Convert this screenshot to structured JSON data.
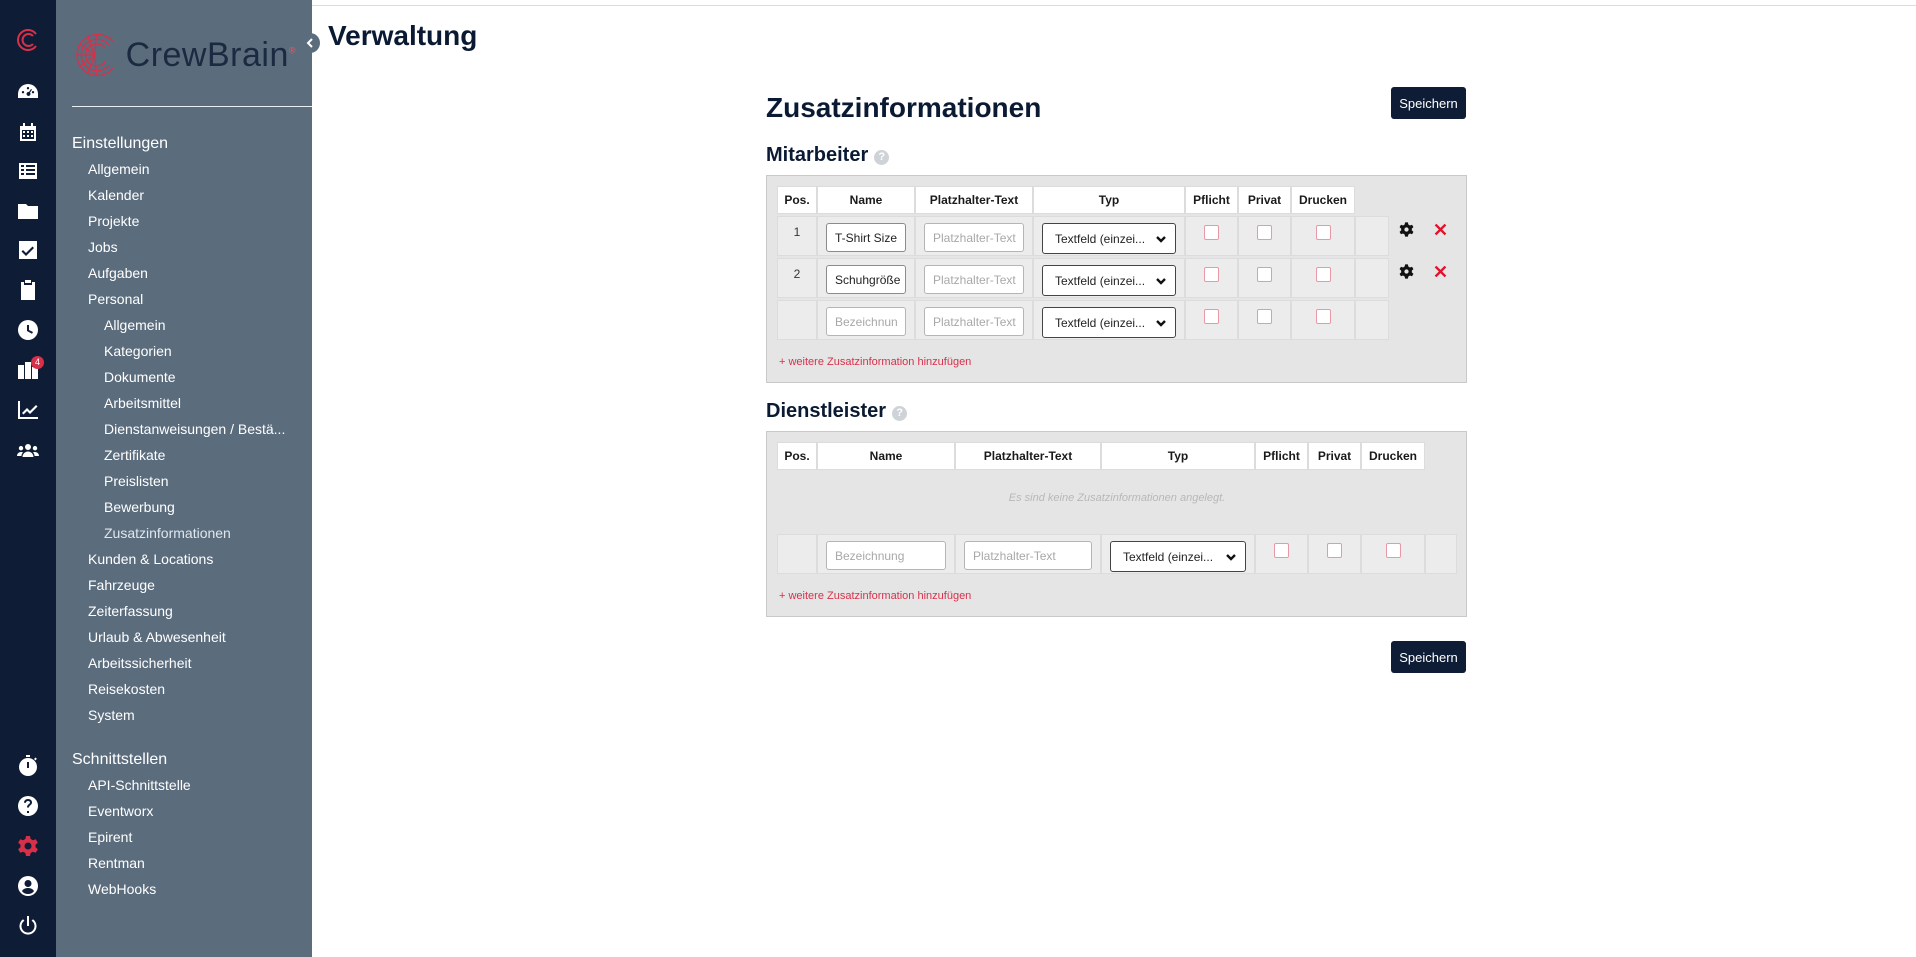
{
  "app": {
    "logo_text": "CrewBrain",
    "logo_mark": "®"
  },
  "page": {
    "title": "Verwaltung",
    "heading": "Zusatzinformationen",
    "save_label": "Speichern"
  },
  "rail": {
    "icons": [
      "logo-icon",
      "dashboard-icon",
      "calendar-icon",
      "list-icon",
      "folder-icon",
      "checkbox-icon",
      "clipboard-icon",
      "clock-icon",
      "tasks-icon",
      "chart-icon",
      "users-icon",
      "stopwatch-icon",
      "help-icon",
      "gear-icon",
      "user-circle-icon",
      "power-icon"
    ],
    "badge": "4",
    "accent": "#d9304a"
  },
  "sidebar": {
    "section1": "Einstellungen",
    "items": [
      "Allgemein",
      "Kalender",
      "Projekte",
      "Jobs",
      "Aufgaben",
      "Personal"
    ],
    "personal_sub": [
      "Allgemein",
      "Kategorien",
      "Dokumente",
      "Arbeitsmittel",
      "Dienstanweisungen / Bestä...",
      "Zertifikate",
      "Preislisten",
      "Bewerbung",
      "Zusatzinformationen"
    ],
    "items2": [
      "Kunden & Locations",
      "Fahrzeuge",
      "Zeiterfassung",
      "Urlaub & Abwesenheit",
      "Arbeitssicherheit",
      "Reisekosten",
      "System"
    ],
    "section2": "Schnittstellen",
    "interfaces": [
      "API-Schnittstelle",
      "Eventworx",
      "Epirent",
      "Rentman",
      "WebHooks"
    ]
  },
  "mitarbeiter": {
    "title": "Mitarbeiter",
    "help": "?",
    "headers": [
      "Pos.",
      "Name",
      "Platzhalter-Text",
      "Typ",
      "Pflicht",
      "Privat",
      "Drucken"
    ],
    "rows": [
      {
        "pos": "1",
        "name": "T-Shirt Size",
        "placeholder": "Platzhalter-Text",
        "type": "Textfeld (einzei..."
      },
      {
        "pos": "2",
        "name": "Schuhgröße",
        "placeholder": "Platzhalter-Text",
        "type": "Textfeld (einzei..."
      }
    ],
    "new_row": {
      "name_placeholder": "Bezeichnun",
      "placeholder_placeholder": "Platzhalter-Text",
      "type": "Textfeld (einzei..."
    },
    "add_link": "+ weitere Zusatzinformation hinzufügen"
  },
  "dienstleister": {
    "title": "Dienstleister",
    "help": "?",
    "headers": [
      "Pos.",
      "Name",
      "Platzhalter-Text",
      "Typ",
      "Pflicht",
      "Privat",
      "Drucken"
    ],
    "empty_text": "Es sind keine Zusatzinformationen angelegt.",
    "new_row": {
      "name_placeholder": "Bezeichnung",
      "placeholder_placeholder": "Platzhalter-Text",
      "type": "Textfeld (einzei..."
    },
    "add_link": "+ weitere Zusatzinformation hinzufügen"
  }
}
